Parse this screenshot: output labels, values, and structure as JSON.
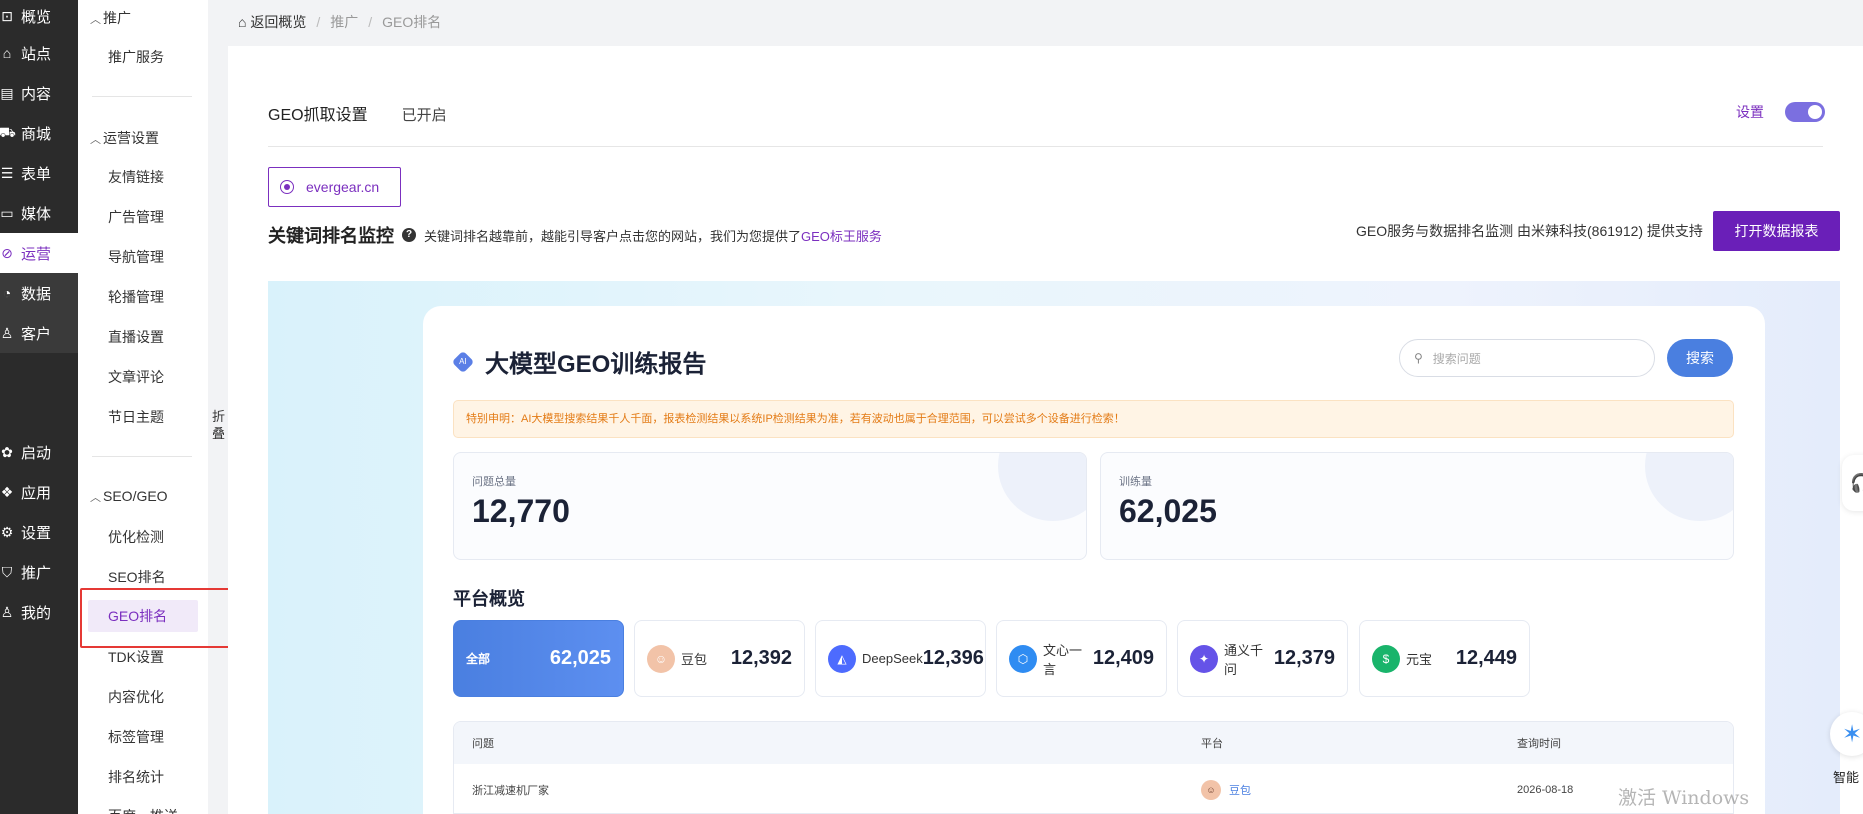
{
  "rail": [
    {
      "icon": "chart-icon",
      "glyph": "⊡",
      "label": "概览"
    },
    {
      "icon": "home-icon",
      "glyph": "⌂",
      "label": "站点"
    },
    {
      "icon": "document-icon",
      "glyph": "▤",
      "label": "内容"
    },
    {
      "icon": "cart-icon",
      "glyph": "⛟",
      "label": "商城"
    },
    {
      "icon": "form-icon",
      "glyph": "☰",
      "label": "表单"
    },
    {
      "icon": "media-icon",
      "glyph": "▭",
      "label": "媒体"
    },
    {
      "icon": "paperclip-icon",
      "glyph": "⊘",
      "label": "运营"
    },
    {
      "icon": "pie-icon",
      "glyph": "◔",
      "label": "数据"
    },
    {
      "icon": "user-icon",
      "glyph": "♙",
      "label": "客户"
    },
    {
      "icon": "launch-icon",
      "glyph": "✿",
      "label": "启动"
    },
    {
      "icon": "apps-icon",
      "glyph": "❖",
      "label": "应用"
    },
    {
      "icon": "gear-icon",
      "glyph": "⚙",
      "label": "设置"
    },
    {
      "icon": "bag-icon",
      "glyph": "⛉",
      "label": "推广"
    },
    {
      "icon": "user-icon",
      "glyph": "♙",
      "label": "我的"
    }
  ],
  "subnav": {
    "group1": "推广",
    "group1_items": [
      "推广服务"
    ],
    "group2": "运营设置",
    "group2_items": [
      "友情链接",
      "广告管理",
      "导航管理",
      "轮播管理",
      "直播设置",
      "文章评论",
      "节日主题"
    ],
    "group3": "SEO/GEO",
    "group3_items": [
      "优化检测",
      "SEO排名",
      "GEO排名",
      "TDK设置",
      "内容优化",
      "标签管理",
      "排名统计",
      "百度一推送"
    ],
    "fold_label": "折叠"
  },
  "breadcrumb": {
    "home": "返回概览",
    "sep": "/",
    "level1": "推广",
    "level2": "GEO排名"
  },
  "geo_settings": {
    "title": "GEO抓取设置",
    "status": "已开启",
    "settings_link": "设置",
    "toggle_on": true
  },
  "domain": "evergear.cn",
  "keyword_monitor": {
    "title": "关键词排名监控",
    "help": "?",
    "desc": "关键词排名越靠前，越能引导客户点击您的网站，我们为您提供了",
    "link": "GEO标王服务",
    "provider": "GEO服务与数据排名监测 由米辣科技(861912) 提供支持",
    "open_report": "打开数据报表"
  },
  "report": {
    "badge": "AI",
    "title": "大模型GEO训练报告",
    "search_placeholder": "搜索问题",
    "search_button": "搜索",
    "notice": "特别申明：AI大模型搜索结果千人千面，报表检测结果以系统IP检测结果为准，若有波动也属于合理范围，可以尝试多个设备进行检索！",
    "total_questions_label": "问题总量",
    "total_questions": "12,770",
    "training_label": "训练量",
    "training": "62,025",
    "platform_title": "平台概览",
    "platforms": [
      {
        "name": "全部",
        "value": "62,025",
        "color": "#4a7fe0",
        "icon": "all"
      },
      {
        "name": "豆包",
        "value": "12,392",
        "color": "#f2c3a8",
        "icon": "doubao-icon"
      },
      {
        "name": "DeepSeek",
        "value": "12,396",
        "color": "#4d6bfe",
        "icon": "deepseek-icon"
      },
      {
        "name": "文心一言",
        "value": "12,409",
        "color": "#2f8cf2",
        "icon": "wenxin-icon"
      },
      {
        "name": "通义千问",
        "value": "12,379",
        "color": "#6553e8",
        "icon": "tongyi-icon"
      },
      {
        "name": "元宝",
        "value": "12,449",
        "color": "#19b46b",
        "icon": "yuanbao-icon"
      }
    ],
    "table_headers": [
      "问题",
      "平台",
      "查询时间"
    ],
    "rows": [
      {
        "question": "浙江减速机厂家",
        "platform": "豆包",
        "time": "2026-08-18"
      }
    ]
  },
  "assistant_label": "智能",
  "watermark": "激活 Windows"
}
